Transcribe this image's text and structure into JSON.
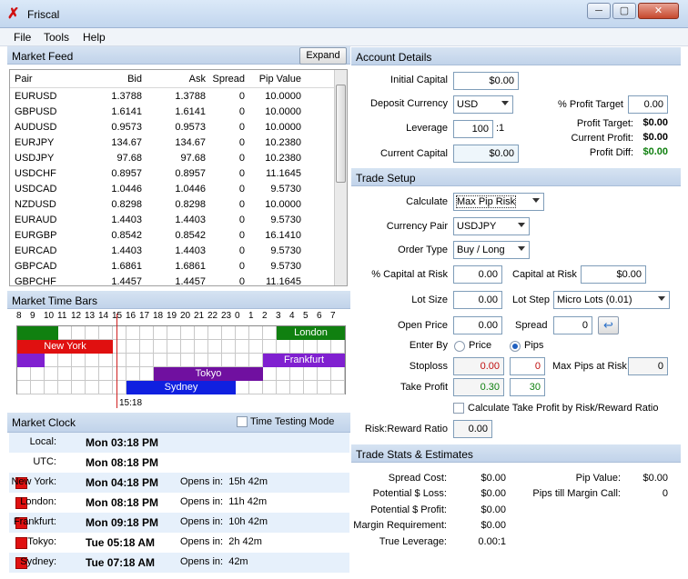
{
  "window": {
    "title": "Friscal",
    "min": "─",
    "max": "▢",
    "close": "✕"
  },
  "menu": [
    "File",
    "Tools",
    "Help"
  ],
  "market_feed": {
    "title": "Market Feed",
    "expand_label": "Expand",
    "columns": [
      "Pair",
      "Bid",
      "Ask",
      "Spread",
      "Pip Value"
    ],
    "rows": [
      [
        "EURUSD",
        "1.3788",
        "1.3788",
        "0",
        "10.0000"
      ],
      [
        "GBPUSD",
        "1.6141",
        "1.6141",
        "0",
        "10.0000"
      ],
      [
        "AUDUSD",
        "0.9573",
        "0.9573",
        "0",
        "10.0000"
      ],
      [
        "EURJPY",
        "134.67",
        "134.67",
        "0",
        "10.2380"
      ],
      [
        "USDJPY",
        "97.68",
        "97.68",
        "0",
        "10.2380"
      ],
      [
        "USDCHF",
        "0.8957",
        "0.8957",
        "0",
        "11.1645"
      ],
      [
        "USDCAD",
        "1.0446",
        "1.0446",
        "0",
        "9.5730"
      ],
      [
        "NZDUSD",
        "0.8298",
        "0.8298",
        "0",
        "10.0000"
      ],
      [
        "EURAUD",
        "1.4403",
        "1.4403",
        "0",
        "9.5730"
      ],
      [
        "EURGBP",
        "0.8542",
        "0.8542",
        "0",
        "16.1410"
      ],
      [
        "EURCAD",
        "1.4403",
        "1.4403",
        "0",
        "9.5730"
      ],
      [
        "GBPCAD",
        "1.6861",
        "1.6861",
        "0",
        "9.5730"
      ],
      [
        "GBPCHF",
        "1.4457",
        "1.4457",
        "0",
        "11.1645"
      ]
    ]
  },
  "time_bars": {
    "title": "Market Time Bars",
    "hours": [
      "8",
      "9",
      "10",
      "11",
      "12",
      "13",
      "14",
      "15",
      "16",
      "17",
      "18",
      "19",
      "20",
      "21",
      "22",
      "23",
      "0",
      "1",
      "2",
      "3",
      "4",
      "5",
      "6",
      "7"
    ],
    "current_time": "15:18",
    "sessions": [
      {
        "name": "London",
        "color": "#108010"
      },
      {
        "name": "New York",
        "color": "#e01010"
      },
      {
        "name": "Frankfurt",
        "color": "#8020d0"
      },
      {
        "name": "Tokyo",
        "color": "#7010a0"
      },
      {
        "name": "Sydney",
        "color": "#1020e0"
      }
    ]
  },
  "market_clock": {
    "title": "Market Clock",
    "time_testing_label": "Time Testing Mode",
    "rows": [
      {
        "label": "Local:",
        "time": "Mon 03:18 PM",
        "opens": ""
      },
      {
        "label": "UTC:",
        "time": "Mon 08:18 PM",
        "opens": ""
      },
      {
        "label": "New York:",
        "time": "Mon 04:18 PM",
        "opens": "Opens in:  15h 42m"
      },
      {
        "label": "London:",
        "time": "Mon 08:18 PM",
        "opens": "Opens in:  11h 42m"
      },
      {
        "label": "Frankfurt:",
        "time": "Mon 09:18 PM",
        "opens": "Opens in:  10h 42m"
      },
      {
        "label": "Tokyo:",
        "time": "Tue 05:18 AM",
        "opens": "Opens in:  2h 42m"
      },
      {
        "label": "Sydney:",
        "time": "Tue 07:18 AM",
        "opens": "Opens in:  42m"
      }
    ]
  },
  "account": {
    "title": "Account Details",
    "initial_capital_label": "Initial Capital",
    "initial_capital": "$0.00",
    "deposit_currency_label": "Deposit Currency",
    "deposit_currency": "USD",
    "leverage_label": "Leverage",
    "leverage": "100",
    "leverage_suffix": ":1",
    "current_capital_label": "Current Capital",
    "current_capital": "$0.00",
    "profit_target_pct_label": "% Profit Target",
    "profit_target_pct": "0.00",
    "profit_target_label": "Profit Target:",
    "profit_target": "$0.00",
    "current_profit_label": "Current Profit:",
    "current_profit": "$0.00",
    "profit_diff_label": "Profit Diff:",
    "profit_diff": "$0.00",
    "profit_diff_color": "#108010"
  },
  "trade_setup": {
    "title": "Trade Setup",
    "calculate_label": "Calculate",
    "calculate": "Max Pip Risk",
    "currency_pair_label": "Currency Pair",
    "currency_pair": "USDJPY",
    "order_type_label": "Order Type",
    "order_type": "Buy / Long",
    "pct_capital_risk_label": "% Capital at Risk",
    "pct_capital_risk": "0.00",
    "capital_risk_label": "Capital at Risk",
    "capital_risk": "$0.00",
    "lot_size_label": "Lot Size",
    "lot_size": "0.00",
    "lot_step_label": "Lot Step",
    "lot_step": "Micro Lots (0.01)",
    "open_price_label": "Open Price",
    "open_price": "0.00",
    "spread_label": "Spread",
    "spread": "0",
    "enter_by_label": "Enter By",
    "enter_price_label": "Price",
    "enter_pips_label": "Pips",
    "stoploss_label": "Stoploss",
    "stoploss_price": "0.00",
    "stoploss_pips": "0",
    "max_pips_label": "Max Pips at Risk",
    "max_pips": "0",
    "take_profit_label": "Take Profit",
    "take_profit_price": "0.30",
    "take_profit_pips": "30",
    "calc_tp_label": "Calculate Take Profit by Risk/Reward Ratio",
    "rr_label": "Risk:Reward Ratio",
    "rr": "0.00"
  },
  "stats": {
    "title": "Trade Stats & Estimates",
    "spread_cost_label": "Spread Cost:",
    "spread_cost": "$0.00",
    "potential_loss_label": "Potential $ Loss:",
    "potential_loss": "$0.00",
    "potential_profit_label": "Potential $ Profit:",
    "potential_profit": "$0.00",
    "margin_req_label": "Margin Requirement:",
    "margin_req": "$0.00",
    "true_leverage_label": "True Leverage:",
    "true_leverage": "0.00:1",
    "pip_value_label": "Pip Value:",
    "pip_value": "$0.00",
    "pips_margin_call_label": "Pips till Margin Call:",
    "pips_margin_call": "0"
  }
}
